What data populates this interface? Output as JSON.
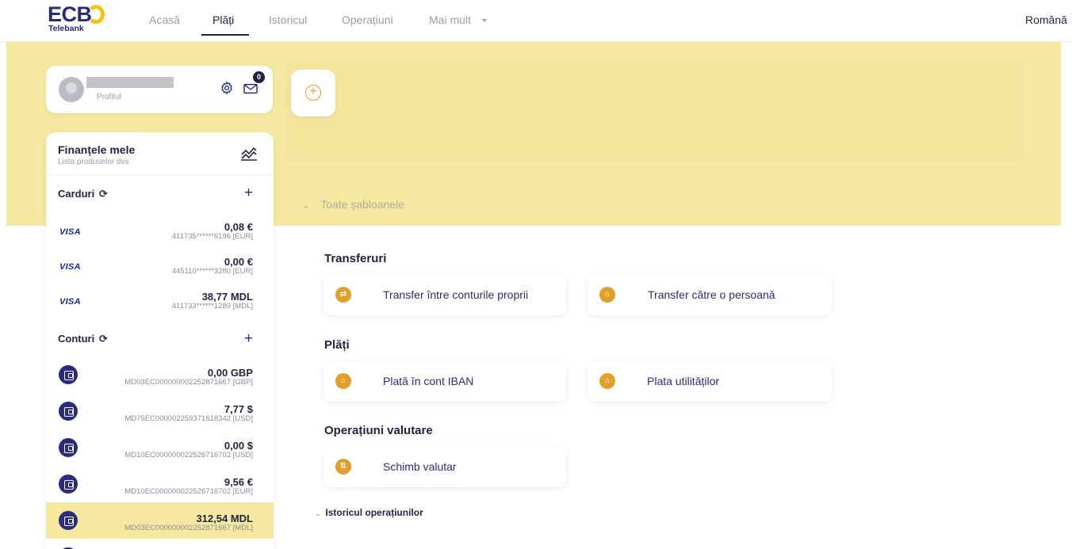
{
  "app": {
    "brand": "ECB",
    "brand_sub": "Telebank",
    "language": "Română"
  },
  "nav": {
    "items": [
      {
        "label": "Acasă"
      },
      {
        "label": "Plăți"
      },
      {
        "label": "Istoricul"
      },
      {
        "label": "Operațiuni"
      },
      {
        "label": "Mai mult"
      }
    ],
    "active": "Plăți"
  },
  "profile": {
    "label": "Profilul",
    "unread_messages": "0"
  },
  "templates": {
    "toggle_label": "Toate șabloanele"
  },
  "finances": {
    "title": "Finanțele mele",
    "subtitle": "Lista produselor dvs",
    "cards_title": "Carduri",
    "accounts_title": "Conturi",
    "cards": [
      {
        "brand": "VISA",
        "amount": "0,08  €",
        "number": "411735******6196 [EUR]"
      },
      {
        "brand": "VISA",
        "amount": "0,00  €",
        "number": "445110******3280 [EUR]"
      },
      {
        "brand": "VISA",
        "amount": "38,77  MDL",
        "number": "411733******1289 [MDL]"
      }
    ],
    "accounts": [
      {
        "amount": "0,00  GBP",
        "iban": "MD03EC000000002252871667 [GBP]"
      },
      {
        "amount": "7,77  $",
        "iban": "MD75EC000002259371618342 [USD]"
      },
      {
        "amount": "0,00  $",
        "iban": "MD10EC000000022526716702 [USD]"
      },
      {
        "amount": "9,56  €",
        "iban": "MD10EC000000022526716702 [EUR]"
      },
      {
        "amount": "312,54  MDL",
        "iban": "MD03EC000000002252871667 [MDL]",
        "selected": true
      }
    ]
  },
  "operations": {
    "groups": [
      {
        "title": "Transferuri",
        "items": [
          {
            "label": "Transfer între conturile proprii",
            "icon": "swap-icon"
          },
          {
            "label": "Transfer către o persoană",
            "icon": "bank-icon"
          }
        ]
      },
      {
        "title": "Plăți",
        "items": [
          {
            "label": "Plată în cont IBAN",
            "icon": "bank-icon"
          },
          {
            "label": "Plata utilităților",
            "icon": "home-icon"
          }
        ]
      },
      {
        "title": "Operațiuni valutare",
        "items": [
          {
            "label": "Schimb valutar",
            "icon": "exchange-icon"
          }
        ]
      }
    ],
    "history_toggle": "Istoricul operațiunilor"
  },
  "colors": {
    "brand_navy": "#2a2c7a",
    "accent_orange": "#e0a02b",
    "band_yellow": "#f5e8a0",
    "logo_yellow": "#f2c30f"
  }
}
